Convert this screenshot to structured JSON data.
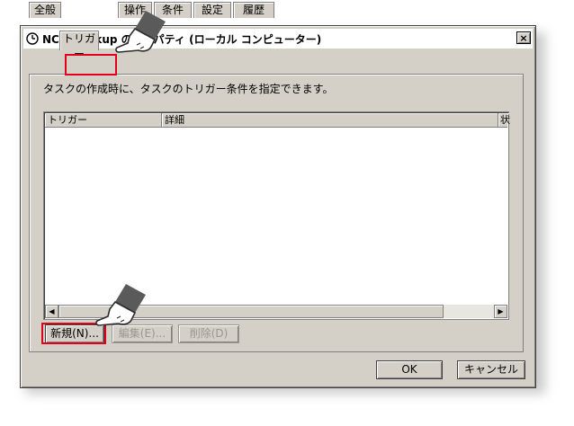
{
  "dialog": {
    "title": "NCB_Backup のプロパティ (ローカル コンピューター)",
    "close_label": "×"
  },
  "tabs": [
    "全般",
    "トリガー",
    "操作",
    "条件",
    "設定",
    "履歴"
  ],
  "active_tab": "トリガー",
  "description": "タスクの作成時に、タスクのトリガー条件を指定できます。",
  "list": {
    "columns": [
      "トリガー",
      "詳細",
      "状"
    ]
  },
  "buttons": {
    "new": "新規(N)...",
    "edit": "編集(E)...",
    "delete": "削除(D)",
    "ok": "OK",
    "cancel": "キャンセル"
  },
  "colors": {
    "highlight": "#e0001a",
    "window_bg": "#d4d0c8"
  },
  "icons": [
    "clock-icon",
    "pointing-hand-icon"
  ]
}
